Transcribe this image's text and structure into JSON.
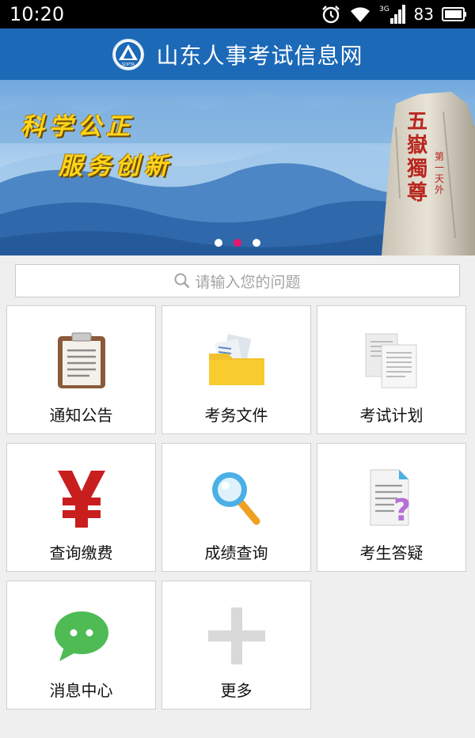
{
  "status": {
    "time": "10:20",
    "network": "3G",
    "battery": "83"
  },
  "header": {
    "title": "山东人事考试信息网",
    "logo_text": "SDPTA"
  },
  "banner": {
    "slogan_line1": "科学公正",
    "slogan_line2": "服务创新",
    "rock_chars": [
      "五",
      "嶽",
      "獨",
      "尊"
    ],
    "rock_small_chars": [
      "第",
      "一",
      "天",
      "外"
    ],
    "slides": 3,
    "active_slide": 2
  },
  "search": {
    "placeholder": "请输入您的问题"
  },
  "tiles": [
    {
      "label": "通知公告",
      "icon": "clipboard-icon"
    },
    {
      "label": "考务文件",
      "icon": "folder-icon"
    },
    {
      "label": "考试计划",
      "icon": "documents-icon"
    },
    {
      "label": "查询缴费",
      "icon": "yen-icon"
    },
    {
      "label": "成绩查询",
      "icon": "magnifier-icon"
    },
    {
      "label": "考生答疑",
      "icon": "question-document-icon"
    },
    {
      "label": "消息中心",
      "icon": "chat-bubble-icon"
    },
    {
      "label": "更多",
      "icon": "plus-icon"
    }
  ],
  "colors": {
    "header_bg": "#1c69b7",
    "active_dot": "#e8166a",
    "slogan": "#ffd51a"
  }
}
